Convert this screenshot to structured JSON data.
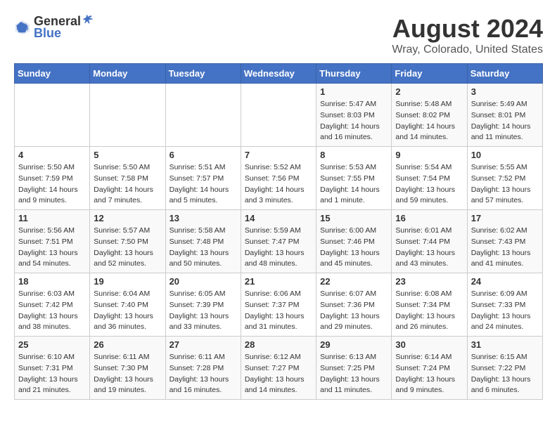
{
  "logo": {
    "text_general": "General",
    "text_blue": "Blue"
  },
  "title": "August 2024",
  "subtitle": "Wray, Colorado, United States",
  "days_header": [
    "Sunday",
    "Monday",
    "Tuesday",
    "Wednesday",
    "Thursday",
    "Friday",
    "Saturday"
  ],
  "weeks": [
    {
      "days": [
        {
          "number": "",
          "info": ""
        },
        {
          "number": "",
          "info": ""
        },
        {
          "number": "",
          "info": ""
        },
        {
          "number": "",
          "info": ""
        },
        {
          "number": "1",
          "info": "Sunrise: 5:47 AM\nSunset: 8:03 PM\nDaylight: 14 hours\nand 16 minutes."
        },
        {
          "number": "2",
          "info": "Sunrise: 5:48 AM\nSunset: 8:02 PM\nDaylight: 14 hours\nand 14 minutes."
        },
        {
          "number": "3",
          "info": "Sunrise: 5:49 AM\nSunset: 8:01 PM\nDaylight: 14 hours\nand 11 minutes."
        }
      ]
    },
    {
      "days": [
        {
          "number": "4",
          "info": "Sunrise: 5:50 AM\nSunset: 7:59 PM\nDaylight: 14 hours\nand 9 minutes."
        },
        {
          "number": "5",
          "info": "Sunrise: 5:50 AM\nSunset: 7:58 PM\nDaylight: 14 hours\nand 7 minutes."
        },
        {
          "number": "6",
          "info": "Sunrise: 5:51 AM\nSunset: 7:57 PM\nDaylight: 14 hours\nand 5 minutes."
        },
        {
          "number": "7",
          "info": "Sunrise: 5:52 AM\nSunset: 7:56 PM\nDaylight: 14 hours\nand 3 minutes."
        },
        {
          "number": "8",
          "info": "Sunrise: 5:53 AM\nSunset: 7:55 PM\nDaylight: 14 hours\nand 1 minute."
        },
        {
          "number": "9",
          "info": "Sunrise: 5:54 AM\nSunset: 7:54 PM\nDaylight: 13 hours\nand 59 minutes."
        },
        {
          "number": "10",
          "info": "Sunrise: 5:55 AM\nSunset: 7:52 PM\nDaylight: 13 hours\nand 57 minutes."
        }
      ]
    },
    {
      "days": [
        {
          "number": "11",
          "info": "Sunrise: 5:56 AM\nSunset: 7:51 PM\nDaylight: 13 hours\nand 54 minutes."
        },
        {
          "number": "12",
          "info": "Sunrise: 5:57 AM\nSunset: 7:50 PM\nDaylight: 13 hours\nand 52 minutes."
        },
        {
          "number": "13",
          "info": "Sunrise: 5:58 AM\nSunset: 7:48 PM\nDaylight: 13 hours\nand 50 minutes."
        },
        {
          "number": "14",
          "info": "Sunrise: 5:59 AM\nSunset: 7:47 PM\nDaylight: 13 hours\nand 48 minutes."
        },
        {
          "number": "15",
          "info": "Sunrise: 6:00 AM\nSunset: 7:46 PM\nDaylight: 13 hours\nand 45 minutes."
        },
        {
          "number": "16",
          "info": "Sunrise: 6:01 AM\nSunset: 7:44 PM\nDaylight: 13 hours\nand 43 minutes."
        },
        {
          "number": "17",
          "info": "Sunrise: 6:02 AM\nSunset: 7:43 PM\nDaylight: 13 hours\nand 41 minutes."
        }
      ]
    },
    {
      "days": [
        {
          "number": "18",
          "info": "Sunrise: 6:03 AM\nSunset: 7:42 PM\nDaylight: 13 hours\nand 38 minutes."
        },
        {
          "number": "19",
          "info": "Sunrise: 6:04 AM\nSunset: 7:40 PM\nDaylight: 13 hours\nand 36 minutes."
        },
        {
          "number": "20",
          "info": "Sunrise: 6:05 AM\nSunset: 7:39 PM\nDaylight: 13 hours\nand 33 minutes."
        },
        {
          "number": "21",
          "info": "Sunrise: 6:06 AM\nSunset: 7:37 PM\nDaylight: 13 hours\nand 31 minutes."
        },
        {
          "number": "22",
          "info": "Sunrise: 6:07 AM\nSunset: 7:36 PM\nDaylight: 13 hours\nand 29 minutes."
        },
        {
          "number": "23",
          "info": "Sunrise: 6:08 AM\nSunset: 7:34 PM\nDaylight: 13 hours\nand 26 minutes."
        },
        {
          "number": "24",
          "info": "Sunrise: 6:09 AM\nSunset: 7:33 PM\nDaylight: 13 hours\nand 24 minutes."
        }
      ]
    },
    {
      "days": [
        {
          "number": "25",
          "info": "Sunrise: 6:10 AM\nSunset: 7:31 PM\nDaylight: 13 hours\nand 21 minutes."
        },
        {
          "number": "26",
          "info": "Sunrise: 6:11 AM\nSunset: 7:30 PM\nDaylight: 13 hours\nand 19 minutes."
        },
        {
          "number": "27",
          "info": "Sunrise: 6:11 AM\nSunset: 7:28 PM\nDaylight: 13 hours\nand 16 minutes."
        },
        {
          "number": "28",
          "info": "Sunrise: 6:12 AM\nSunset: 7:27 PM\nDaylight: 13 hours\nand 14 minutes."
        },
        {
          "number": "29",
          "info": "Sunrise: 6:13 AM\nSunset: 7:25 PM\nDaylight: 13 hours\nand 11 minutes."
        },
        {
          "number": "30",
          "info": "Sunrise: 6:14 AM\nSunset: 7:24 PM\nDaylight: 13 hours\nand 9 minutes."
        },
        {
          "number": "31",
          "info": "Sunrise: 6:15 AM\nSunset: 7:22 PM\nDaylight: 13 hours\nand 6 minutes."
        }
      ]
    }
  ]
}
